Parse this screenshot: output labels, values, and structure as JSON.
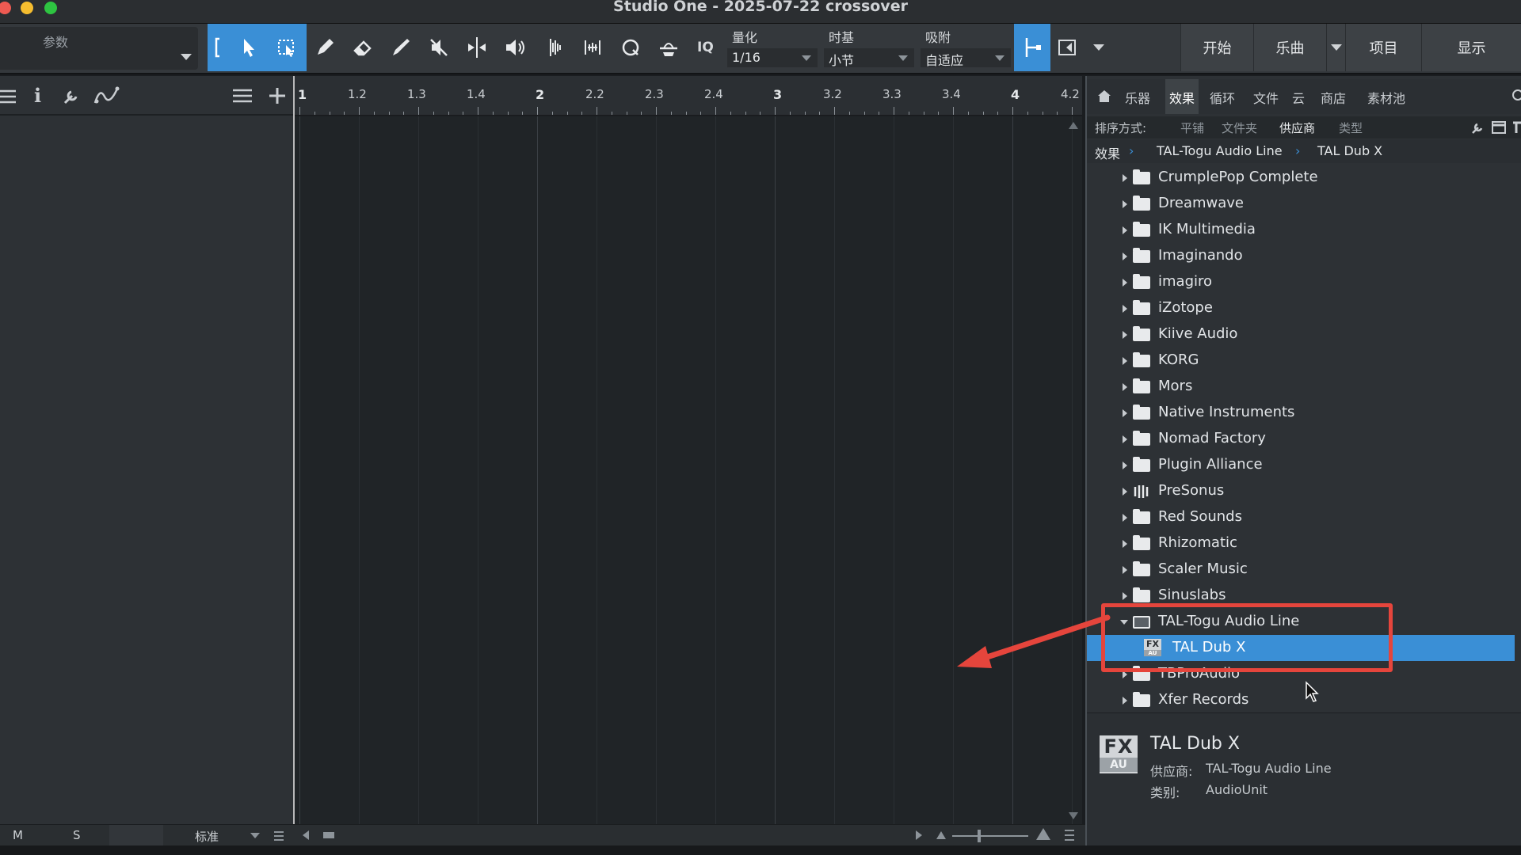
{
  "window": {
    "title": "Studio One - 2025-07-22 crossover"
  },
  "toolbar": {
    "param_label": "参数",
    "quantize": {
      "label": "量化",
      "value": "1/16"
    },
    "timebase": {
      "label": "时基",
      "value": "小节"
    },
    "snap": {
      "label": "吸附",
      "value": "自适应"
    },
    "iq_label": "IQ",
    "nav": [
      "开始",
      "乐曲",
      "项目",
      "显示"
    ]
  },
  "ruler": {
    "labels": [
      "1",
      "1.2",
      "1.3",
      "1.4",
      "2",
      "2.2",
      "2.3",
      "2.4",
      "3",
      "3.2",
      "3.3",
      "3.4",
      "4",
      "4.2"
    ]
  },
  "browser": {
    "tabs": [
      "乐器",
      "效果",
      "循环",
      "文件",
      "云",
      "商店",
      "素材池"
    ],
    "active_tab": "效果",
    "sort_label": "排序方式:",
    "sort_options": [
      "平铺",
      "文件夹",
      "供应商",
      "类型"
    ],
    "active_sort": "供应商",
    "breadcrumb": [
      "效果",
      "TAL-Togu Audio Line",
      "TAL Dub X"
    ],
    "tree": [
      {
        "label": "CrumplePop Complete",
        "kind": "folder"
      },
      {
        "label": "Dreamwave",
        "kind": "folder"
      },
      {
        "label": "IK Multimedia",
        "kind": "folder"
      },
      {
        "label": "Imaginando",
        "kind": "folder"
      },
      {
        "label": "imagiro",
        "kind": "folder"
      },
      {
        "label": "iZotope",
        "kind": "folder"
      },
      {
        "label": "Kiive Audio",
        "kind": "folder"
      },
      {
        "label": "KORG",
        "kind": "folder"
      },
      {
        "label": "Mors",
        "kind": "folder"
      },
      {
        "label": "Native Instruments",
        "kind": "folder"
      },
      {
        "label": "Nomad Factory",
        "kind": "folder"
      },
      {
        "label": "Plugin Alliance",
        "kind": "folder"
      },
      {
        "label": "PreSonus",
        "kind": "presonus"
      },
      {
        "label": "Red Sounds",
        "kind": "folder"
      },
      {
        "label": "Rhizomatic",
        "kind": "folder"
      },
      {
        "label": "Scaler Music",
        "kind": "folder"
      },
      {
        "label": "Sinuslabs",
        "kind": "folder"
      },
      {
        "label": "TAL-Togu Audio Line",
        "kind": "open-folder"
      },
      {
        "label": "TAL Dub X",
        "kind": "plugin",
        "selected": true
      },
      {
        "label": "TBProAudio",
        "kind": "folder"
      },
      {
        "label": "Xfer Records",
        "kind": "folder"
      }
    ],
    "info": {
      "badge_top": "FX",
      "badge_bottom": "AU",
      "name": "TAL Dub X",
      "vendor_label": "供应商:",
      "vendor": "TAL-Togu Audio Line",
      "category_label": "类别:",
      "category": "AudioUnit"
    }
  },
  "bottom": {
    "m": "M",
    "s": "S",
    "mode": "标准"
  },
  "colors": {
    "accent": "#3a8fd6",
    "highlight": "#e5453c"
  }
}
